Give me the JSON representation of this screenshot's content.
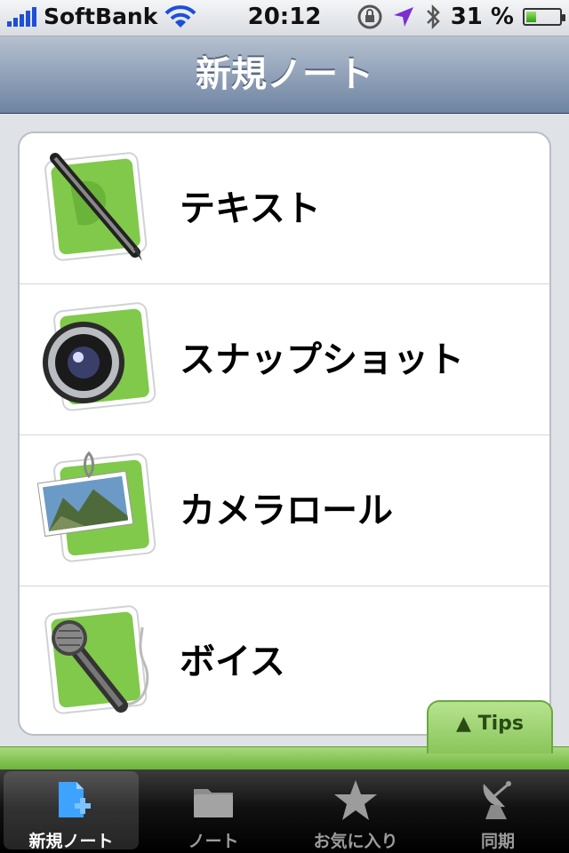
{
  "status_bar": {
    "carrier": "SoftBank",
    "time": "20:12",
    "battery": "31 %",
    "battery_level": 0.31
  },
  "nav": {
    "title": "新規ノート"
  },
  "list": {
    "items": [
      {
        "label": "テキスト",
        "icon": "pen-note-icon"
      },
      {
        "label": "スナップショット",
        "icon": "camera-note-icon"
      },
      {
        "label": "カメラロール",
        "icon": "photo-note-icon"
      },
      {
        "label": "ボイス",
        "icon": "microphone-note-icon"
      }
    ]
  },
  "tips": {
    "label": "Tips"
  },
  "tabbar": {
    "tabs": [
      {
        "label": "新規ノート",
        "icon": "new-note-icon",
        "active": true
      },
      {
        "label": "ノート",
        "icon": "folder-icon",
        "active": false
      },
      {
        "label": "お気に入り",
        "icon": "star-icon",
        "active": false
      },
      {
        "label": "同期",
        "icon": "satellite-dish-icon",
        "active": false
      }
    ]
  },
  "colors": {
    "accent_green": "#8ac55a",
    "nav_blue": "#6e84a2"
  }
}
